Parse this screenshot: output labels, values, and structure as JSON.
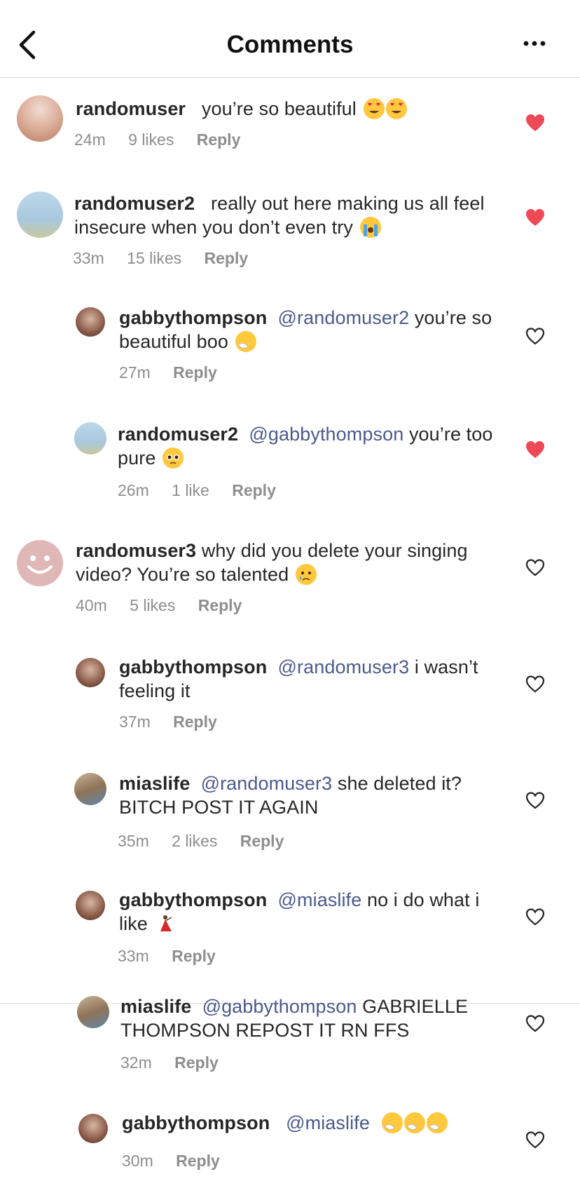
{
  "header": {
    "title": "Comments",
    "back_icon": "chevron-left-icon",
    "more_icon": "more-dots-icon"
  },
  "colors": {
    "heart_liked": "#ed4956",
    "mention": "#4b5a8c",
    "meta_gray": "#8e8e8e"
  },
  "comments": [
    {
      "username": "randomuser",
      "mention": "",
      "text": "you’re so beautiful",
      "emoji": [
        "heart-eyes-emoji",
        "heart-eyes-emoji"
      ],
      "time": "24m",
      "likes": "9 likes",
      "reply": "Reply",
      "liked": true
    },
    {
      "username": "randomuser2",
      "mention": "",
      "text": "really out here making us all feel insecure when you don’t even try",
      "emoji": [
        "loudly-crying-emoji"
      ],
      "time": "33m",
      "likes": "15 likes",
      "reply": "Reply",
      "liked": true
    },
    {
      "username": "gabbythompson",
      "mention": "@randomuser2",
      "text": "you’re so beautiful boo",
      "emoji": [
        "sneezing-emoji"
      ],
      "time": "27m",
      "likes": "",
      "reply": "Reply",
      "liked": false
    },
    {
      "username": "randomuser2",
      "mention": "@gabbythompson",
      "text": "you’re too pure",
      "emoji": [
        "pleading-emoji"
      ],
      "time": "26m",
      "likes": "1 like",
      "reply": "Reply",
      "liked": true
    },
    {
      "username": "randomuser3",
      "mention": "",
      "text": "why did you delete your singing video? You’re so talented",
      "emoji": [
        "crying-emoji"
      ],
      "time": "40m",
      "likes": "5 likes",
      "reply": "Reply",
      "liked": false
    },
    {
      "username": "gabbythompson",
      "mention": "@randomuser3",
      "text": "i wasn’t feeling it",
      "emoji": [],
      "time": "37m",
      "likes": "",
      "reply": "Reply",
      "liked": false
    },
    {
      "username": "miaslife",
      "mention": "@randomuser3",
      "text": "she deleted it? BITCH POST IT AGAIN",
      "emoji": [],
      "time": "35m",
      "likes": "2 likes",
      "reply": "Reply",
      "liked": false
    },
    {
      "username": "gabbythompson",
      "mention": "@miaslife",
      "text": "no i do what i like",
      "emoji": [
        "dancer-emoji"
      ],
      "time": "33m",
      "likes": "",
      "reply": "Reply",
      "liked": false
    },
    {
      "username": "miaslife",
      "mention": "@gabbythompson",
      "text": "GABRIELLE THOMPSON REPOST IT RN FFS",
      "emoji": [],
      "time": "32m",
      "likes": "",
      "reply": "Reply",
      "liked": false
    },
    {
      "username": "gabbythompson",
      "mention": "@miaslife",
      "text": "",
      "emoji": [
        "sneezing-emoji",
        "sneezing-emoji",
        "sneezing-emoji"
      ],
      "time": "30m",
      "likes": "",
      "reply": "Reply",
      "liked": false
    }
  ]
}
